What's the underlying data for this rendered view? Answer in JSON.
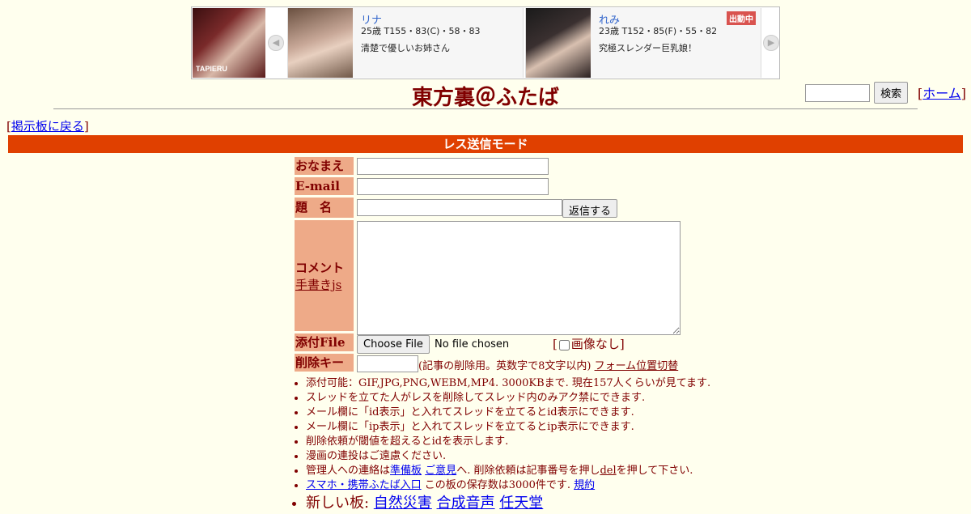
{
  "banner": {
    "logo_text": "TAPIERU",
    "prev_icon": "◀",
    "next_icon": "▶",
    "cards": [
      {
        "name": "リナ",
        "spec": "25歳 T155・83(C)・58・83",
        "desc": "清楚で優しいお姉さん",
        "badge": ""
      },
      {
        "name": "れみ",
        "spec": "23歳 T152・85(F)・55・82",
        "desc": "究極スレンダー巨乳娘！",
        "badge": "出動中"
      }
    ]
  },
  "header": {
    "title": "東方裏＠ふたば",
    "search_button": "検索",
    "home_prefix": "[",
    "home_link": "ホーム",
    "home_suffix": "]"
  },
  "back": {
    "prefix": "[",
    "link": "掲示板に戻る",
    "suffix": "]"
  },
  "mode_title": "レス送信モード",
  "form": {
    "name_label": "おなまえ",
    "email_label": "E-mail",
    "subject_label": "題　名",
    "submit_label": "返信する",
    "comment_label": "コメント",
    "handwriting_link": "手書きjs",
    "file_label": "添付File",
    "choose_file": "Choose File",
    "no_file": "No file chosen",
    "no_image_open": "[",
    "no_image_label": "画像なし]",
    "delkey_label": "削除キー",
    "delkey_note": "(記事の削除用。英数字で8文字以内)",
    "form_toggle": "フォーム位置切替"
  },
  "notes": [
    {
      "text": "添付可能：GIF,JPG,PNG,WEBM,MP4. 3000KBまで. 現在157人くらいが見てます."
    },
    {
      "text": "スレッドを立てた人がレスを削除してスレッド内のみアク禁にできます."
    },
    {
      "text": "メール欄に「id表示」と入れてスレッドを立てるとid表示にできます."
    },
    {
      "text": "メール欄に「ip表示」と入れてスレッドを立てるとip表示にできます."
    },
    {
      "text": "削除依頼が閾値を超えるとidを表示します."
    },
    {
      "text": "漫画の連投はご遠慮ください."
    }
  ],
  "contact": {
    "prefix": "管理人への連絡は",
    "link1": "準備板",
    "link2": "ご意見",
    "middle": "へ. 削除依頼は記事番号を押し",
    "del": "del",
    "suffix": "を押して下さい."
  },
  "mobile": {
    "link": "スマホ・携帯ふたば入口",
    "text": " この板の保存数は3000件です. ",
    "rules": "規約"
  },
  "newboards": {
    "label": "新しい板: ",
    "links": [
      "自然災害",
      "合成音声",
      "任天堂"
    ]
  }
}
